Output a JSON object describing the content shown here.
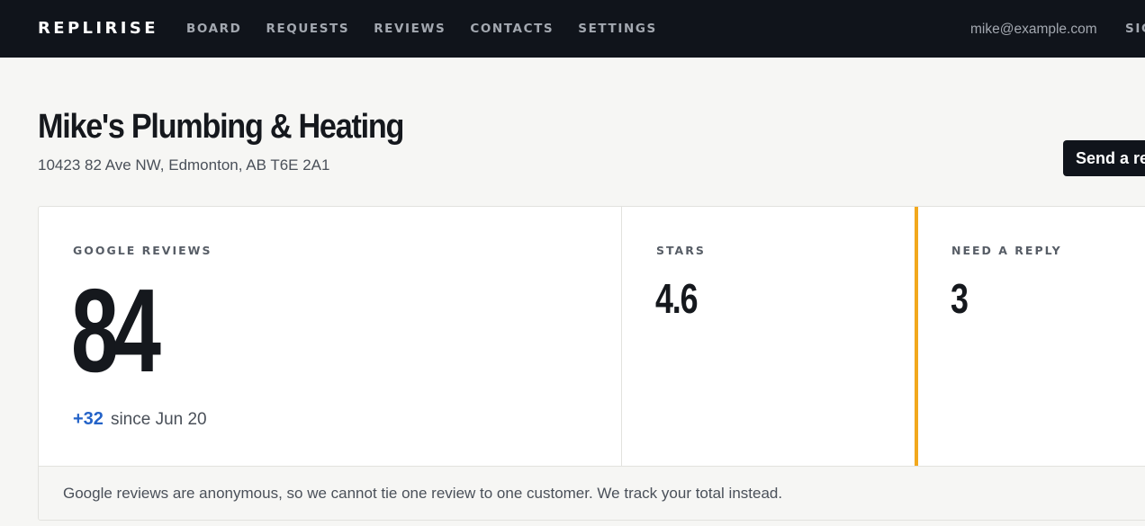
{
  "nav": {
    "brand": "REPLIRISE",
    "items": [
      {
        "label": "BOARD"
      },
      {
        "label": "REQUESTS"
      },
      {
        "label": "REVIEWS"
      },
      {
        "label": "CONTACTS"
      },
      {
        "label": "SETTINGS"
      }
    ],
    "user_email": "mike@example.com",
    "signout_label": "SIGN OUT"
  },
  "header": {
    "business_name": "Mike's Plumbing & Heating",
    "address": "10423 82 Ave NW, Edmonton, AB T6E 2A1",
    "cta_label": "Send a request"
  },
  "stats": {
    "reviews": {
      "label": "GOOGLE REVIEWS",
      "value": "84",
      "delta": "+32",
      "delta_text": "since Jun 20"
    },
    "stars": {
      "label": "STARS",
      "value": "4.6"
    },
    "reply": {
      "label": "NEED A REPLY",
      "value": "3"
    }
  },
  "footer_note": "Google reviews are anonymous, so we cannot tie one review to one customer. We track your total instead.",
  "colors": {
    "nav_bg": "#10141b",
    "page_bg": "#f6f6f4",
    "accent_blue": "#2463c8",
    "attention_orange": "#f2a81d"
  }
}
